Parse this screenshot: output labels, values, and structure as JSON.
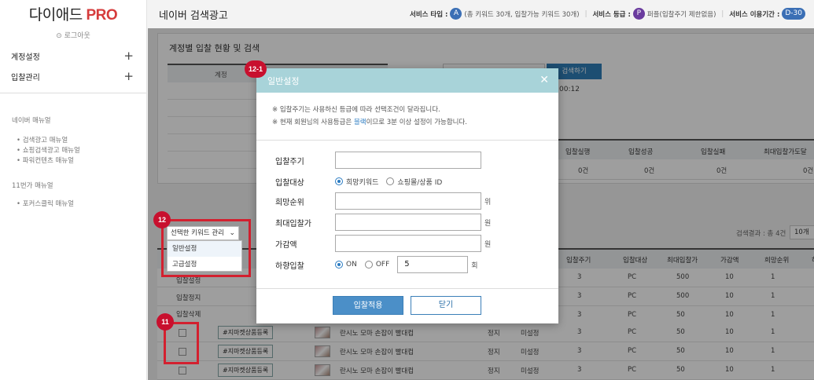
{
  "brand": {
    "logo_main": "다이애드",
    "logo_pro": "PRO",
    "logout": "⊙ 로그아웃"
  },
  "sidebar": {
    "menus": [
      {
        "label": "계정설정"
      },
      {
        "label": "입찰관리"
      }
    ],
    "naver_manual_title": "네이버 매뉴얼",
    "naver_manual_links": [
      "• 검색광고 매뉴얼",
      "• 쇼핑검색광고 매뉴얼",
      "• 파워컨텐츠 매뉴얼"
    ],
    "st11_manual_title": "11번가 매뉴얼",
    "st11_manual_links": [
      "• 포커스클릭 매뉴얼"
    ]
  },
  "header": {
    "title": "네이버 검색광고",
    "service_type_label": "서비스 타입 :",
    "service_type_badge": "A",
    "service_type_text": "(총 키워드 30개, 입찰가능 키워드 30개)",
    "service_grade_label": "서비스 등급 :",
    "service_grade_badge": "P",
    "service_grade_text": "퍼플(입찰주기 제한없음)",
    "service_period_label": "서비스 이용기간 :",
    "service_period_badge": "D-30"
  },
  "status_panel": {
    "title": "계정별 입찰 현황 및 검색",
    "col_account": "계정",
    "search_button": "검색하기",
    "time": "00:12",
    "stat_headers": [
      "입찰실행",
      "입찰성공",
      "입찰실패",
      "최대입찰가도달"
    ],
    "stat_values": [
      "0건",
      "0건",
      "0건",
      "0건"
    ]
  },
  "grid": {
    "result_count": "검색결과 : 총 4건",
    "page_size": "10개",
    "headers": [
      "입찰주기",
      "입찰대상",
      "최대입찰가",
      "가감액",
      "희망순위",
      "하"
    ],
    "rows": [
      {
        "tag": "#지마켓상품등록",
        "name": "란시노 모마 손잡이 빨대컵",
        "status": "정지",
        "state": "미설정",
        "cycle": "3",
        "target": "PC",
        "max": "500",
        "step": "10",
        "rank": "1"
      },
      {
        "tag": "#지마켓상품등록",
        "name": "란시노 모마 손잡이 빨대컵",
        "status": "정지",
        "state": "미설정",
        "cycle": "3",
        "target": "PC",
        "max": "500",
        "step": "10",
        "rank": "1"
      },
      {
        "tag": "#지마켓상품등록",
        "name": "란시노 모마 손잡이 빨대컵",
        "status": "정지",
        "state": "미설정",
        "cycle": "3",
        "target": "PC",
        "max": "50",
        "step": "10",
        "rank": "1"
      },
      {
        "tag": "#지마켓상품등록",
        "name": "란시노 모마 손잡이 빨대컵",
        "status": "정지",
        "state": "미설정",
        "cycle": "3",
        "target": "PC",
        "max": "50",
        "step": "10",
        "rank": "1"
      },
      {
        "tag": "#지마켓상품등록",
        "name": "란시노 모마 손잡이 빨대컵",
        "status": "정지",
        "state": "미설정",
        "cycle": "3",
        "target": "PC",
        "max": "50",
        "step": "10",
        "rank": "1"
      },
      {
        "tag": "#지마켓상품등록",
        "name": "란시노 모마 손잡이 빨대컵",
        "status": "정지",
        "state": "미설정",
        "cycle": "3",
        "target": "PC",
        "max": "50",
        "step": "10",
        "rank": "1"
      }
    ],
    "side_actions": [
      "입찰설정",
      "입찰정지",
      "입찰삭제"
    ]
  },
  "keyword_dropdown": {
    "selected": "선택한 키워드 관리",
    "options": [
      "일반설정",
      "고급설정"
    ]
  },
  "annotations": {
    "badge_12": "12",
    "badge_12_1": "12-1",
    "badge_11": "11"
  },
  "modal": {
    "title": "일반설정",
    "notice_1": "※ 입찰주기는 사용하신 등급에 따라 선택조건이 달라집니다.",
    "notice_2_pre": "※ 현재 회원님의 사용등급은 ",
    "notice_2_grade": "블랙",
    "notice_2_mid": "이므로 ",
    "notice_2_min": "3분",
    "notice_2_post": " 이상 설정이 가능합니다.",
    "fields": {
      "cycle": {
        "label": "입찰주기",
        "value": ""
      },
      "target": {
        "label": "입찰대상",
        "opt1": "희망키워드",
        "opt2": "쇼핑몰/상품 ID"
      },
      "rank": {
        "label": "희망순위",
        "value": "",
        "unit": "위"
      },
      "max_bid": {
        "label": "최대입찰가",
        "value": "",
        "unit": "원"
      },
      "step": {
        "label": "가감액",
        "value": "",
        "unit": "원"
      },
      "down_bid": {
        "label": "하향입찰",
        "on": "ON",
        "off": "OFF",
        "value": "5",
        "unit": "회"
      }
    },
    "apply_button": "입찰적용",
    "close_button": "닫기"
  }
}
